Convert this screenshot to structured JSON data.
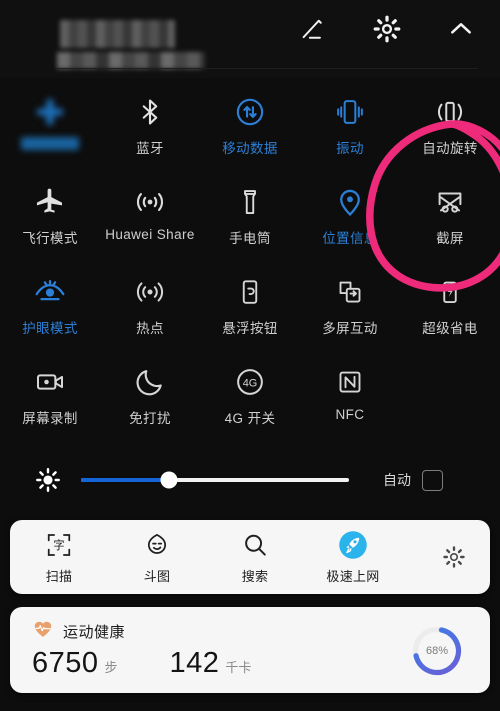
{
  "statusbar": {
    "redacted_line1": "",
    "redacted_line2": ""
  },
  "topbar": {
    "edit_icon": "pencil-icon",
    "settings_icon": "gear-icon",
    "collapse_icon": "chevron-up-icon"
  },
  "toggles": [
    [
      {
        "label": "",
        "icon": "wifi-icon",
        "state": "on",
        "blurred": true
      },
      {
        "label": "蓝牙",
        "icon": "bluetooth-icon",
        "state": "off",
        "blurred": false
      },
      {
        "label": "移动数据",
        "icon": "mobile-data-icon",
        "state": "on",
        "blurred": false
      },
      {
        "label": "振动",
        "icon": "vibrate-icon",
        "state": "on",
        "blurred": false
      },
      {
        "label": "自动旋转",
        "icon": "auto-rotate-icon",
        "state": "off",
        "blurred": false
      }
    ],
    [
      {
        "label": "飞行模式",
        "icon": "airplane-icon",
        "state": "off",
        "blurred": false
      },
      {
        "label": "Huawei Share",
        "icon": "huawei-share-icon",
        "state": "off",
        "blurred": false
      },
      {
        "label": "手电筒",
        "icon": "flashlight-icon",
        "state": "off",
        "blurred": false
      },
      {
        "label": "位置信息",
        "icon": "location-pin-icon",
        "state": "on",
        "blurred": false
      },
      {
        "label": "截屏",
        "icon": "screenshot-icon",
        "state": "off",
        "blurred": false
      }
    ],
    [
      {
        "label": "护眼模式",
        "icon": "eye-comfort-icon",
        "state": "on",
        "blurred": false
      },
      {
        "label": "热点",
        "icon": "hotspot-icon",
        "state": "off",
        "blurred": false
      },
      {
        "label": "悬浮按钮",
        "icon": "floating-button-icon",
        "state": "off",
        "blurred": false
      },
      {
        "label": "多屏互动",
        "icon": "multi-screen-icon",
        "state": "off",
        "blurred": false
      },
      {
        "label": "超级省电",
        "icon": "ultra-power-save-icon",
        "state": "off",
        "blurred": false
      }
    ],
    [
      {
        "label": "屏幕录制",
        "icon": "screen-record-icon",
        "state": "off",
        "blurred": false
      },
      {
        "label": "免打扰",
        "icon": "do-not-disturb-icon",
        "state": "off",
        "blurred": false
      },
      {
        "label": "4G 开关",
        "icon": "4g-switch-icon",
        "state": "off",
        "blurred": false
      },
      {
        "label": "NFC",
        "icon": "nfc-icon",
        "state": "off",
        "blurred": false
      },
      {
        "label": "",
        "icon": "",
        "state": "empty",
        "blurred": false
      }
    ]
  ],
  "brightness": {
    "icon": "brightness-sun-icon",
    "value_percent": 33,
    "auto_label": "自动",
    "auto_checked": false
  },
  "shortcuts": {
    "items": [
      {
        "label": "扫描",
        "icon": "scan-text-icon"
      },
      {
        "label": "斗图",
        "icon": "meme-face-icon"
      },
      {
        "label": "搜索",
        "icon": "search-icon"
      },
      {
        "label": "极速上网",
        "icon": "rocket-icon"
      }
    ],
    "settings_icon": "gear-icon"
  },
  "health": {
    "icon": "heart-pulse-icon",
    "title": "运动健康",
    "steps_value": "6750",
    "steps_unit": "步",
    "calories_value": "142",
    "calories_unit": "千卡",
    "ring_percent_label": "68%",
    "ring_percent": 68
  },
  "annotation": {
    "shape": "hand-drawn-circle",
    "color": "#ee2a7b",
    "targets": "截屏"
  },
  "colors": {
    "accent_on": "#2b7fd6",
    "slider_fill": "#1565d8",
    "annotation_pink": "#ee2a7b",
    "ring_start": "#3b7ee8",
    "ring_end": "#6b5fd6"
  }
}
